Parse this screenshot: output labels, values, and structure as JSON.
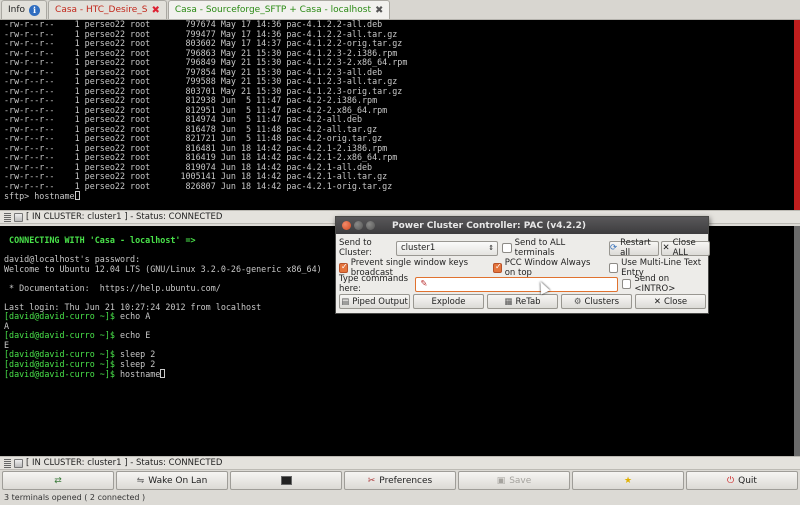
{
  "tabs": [
    {
      "label": "Info",
      "icon": "info-icon"
    },
    {
      "label": "Casa - HTC_Desire_S",
      "color": "#c2281c"
    },
    {
      "label": "Casa - Sourceforge_SFTP + Casa - localhost",
      "color": "#2a8a14"
    }
  ],
  "term1_lines": [
    "-rw-r--r--    1 perseo22 root       797674 May 17 14:36 pac-4.1.2.2-all.deb",
    "-rw-r--r--    1 perseo22 root       799477 May 17 14:36 pac-4.1.2.2-all.tar.gz",
    "-rw-r--r--    1 perseo22 root       803602 May 17 14:37 pac-4.1.2.2-orig.tar.gz",
    "-rw-r--r--    1 perseo22 root       796863 May 21 15:30 pac-4.1.2.3-2.i386.rpm",
    "-rw-r--r--    1 perseo22 root       796849 May 21 15:30 pac-4.1.2.3-2.x86_64.rpm",
    "-rw-r--r--    1 perseo22 root       797854 May 21 15:30 pac-4.1.2.3-all.deb",
    "-rw-r--r--    1 perseo22 root       799588 May 21 15:30 pac-4.1.2.3-all.tar.gz",
    "-rw-r--r--    1 perseo22 root       803701 May 21 15:30 pac-4.1.2.3-orig.tar.gz",
    "-rw-r--r--    1 perseo22 root       812938 Jun  5 11:47 pac-4.2-2.i386.rpm",
    "-rw-r--r--    1 perseo22 root       812951 Jun  5 11:47 pac-4.2-2.x86_64.rpm",
    "-rw-r--r--    1 perseo22 root       814974 Jun  5 11:47 pac-4.2-all.deb",
    "-rw-r--r--    1 perseo22 root       816478 Jun  5 11:48 pac-4.2-all.tar.gz",
    "-rw-r--r--    1 perseo22 root       821721 Jun  5 11:48 pac-4.2-orig.tar.gz",
    "-rw-r--r--    1 perseo22 root       816481 Jun 18 14:42 pac-4.2.1-2.i386.rpm",
    "-rw-r--r--    1 perseo22 root       816419 Jun 18 14:42 pac-4.2.1-2.x86_64.rpm",
    "-rw-r--r--    1 perseo22 root       819074 Jun 18 14:42 pac-4.2.1-all.deb",
    "-rw-r--r--    1 perseo22 root      1005141 Jun 18 14:42 pac-4.2.1-all.tar.gz",
    "-rw-r--r--    1 perseo22 root       826807 Jun 18 14:42 pac-4.2.1-orig.tar.gz"
  ],
  "term1_prompt": "sftp> hostname",
  "status1": "[ IN CLUSTER: cluster1 ] - Status: CONNECTED",
  "term2": {
    "connecting": " CONNECTING WITH 'Casa - localhost' =>",
    "password": "david@localhost's password:",
    "welcome": "Welcome to Ubuntu 12.04 LTS (GNU/Linux 3.2.0-26-generic x86_64)",
    "docs": " * Documentation:  https://help.ubuntu.com/",
    "lastlogin": "Last login: Thu Jun 21 10:27:24 2012 from localhost",
    "prompt": "[david@david-curro ~]$",
    "cmd1": " echo A",
    "out1": "A",
    "cmd2": " echo E",
    "out2": "E",
    "cmd3": " sleep 2",
    "cmd4": " sleep 2",
    "cmd5": " hostname"
  },
  "status2": "[ IN CLUSTER: cluster1 ] - Status: CONNECTED",
  "dialog": {
    "title": "Power Cluster Controller: PAC (v4.2.2)",
    "send_to_label": "Send to Cluster:",
    "cluster_value": "cluster1",
    "send_all_label": "Send to ALL terminals",
    "restart_all": "Restart all",
    "close_all": "Close ALL",
    "prevent_broadcast": "Prevent single window keys broadcast",
    "always_on_top": "PCC Window Always on top",
    "multiline": "Use Multi-Line Text Entry",
    "type_label": "Type commands here:",
    "send_intro": "Send on <INTRO>",
    "piped_output": "Piped Output",
    "explode": "Explode",
    "retab": "ReTab",
    "clusters": "Clusters",
    "close": "Close"
  },
  "toolbar": {
    "wake_on_lan": "Wake On Lan",
    "preferences": "Preferences",
    "save": "Save",
    "quit": "Quit"
  },
  "footer": "3 terminals opened ( 2 connected )",
  "colors": {
    "accent": "#e4743c",
    "connected_green": "#49e24a",
    "tab_red": "#c2281c",
    "tab_green": "#2a8a14"
  }
}
